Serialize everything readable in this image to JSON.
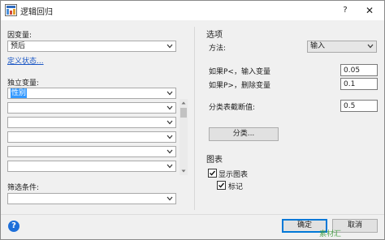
{
  "window": {
    "title": "逻辑回归",
    "help_glyph": "?",
    "close_glyph": "✕"
  },
  "left": {
    "dependent_label": "因变量:",
    "dependent_value": "预后",
    "define_state_link": "定义状态...",
    "independent_label": "独立变量:",
    "independent_values": [
      "性别",
      "",
      "",
      "",
      "",
      "",
      ""
    ],
    "filter_label": "筛选条件:",
    "filter_value": ""
  },
  "options": {
    "title": "选项",
    "method_label": "方法:",
    "method_value": "输入",
    "p_enter_label": "如果P<，输入变量",
    "p_enter_value": "0.05",
    "p_remove_label": "如果P>，删除变量",
    "p_remove_value": "0.1",
    "cutoff_label": "分类表截断值:",
    "cutoff_value": "0.5",
    "classify_button": "分类..."
  },
  "chart": {
    "title": "图表",
    "show_chart_label": "显示图表",
    "show_chart_checked": true,
    "markers_label": "标记",
    "markers_checked": true
  },
  "footer": {
    "ok_button": "确定",
    "cancel_button": "取消",
    "help_glyph": "?"
  },
  "watermark": "素材汇",
  "colors": {
    "link": "#1a56c4",
    "help_icon": "#1e6fd9",
    "primary_border": "#0078d7",
    "selection": "#3399ff"
  }
}
